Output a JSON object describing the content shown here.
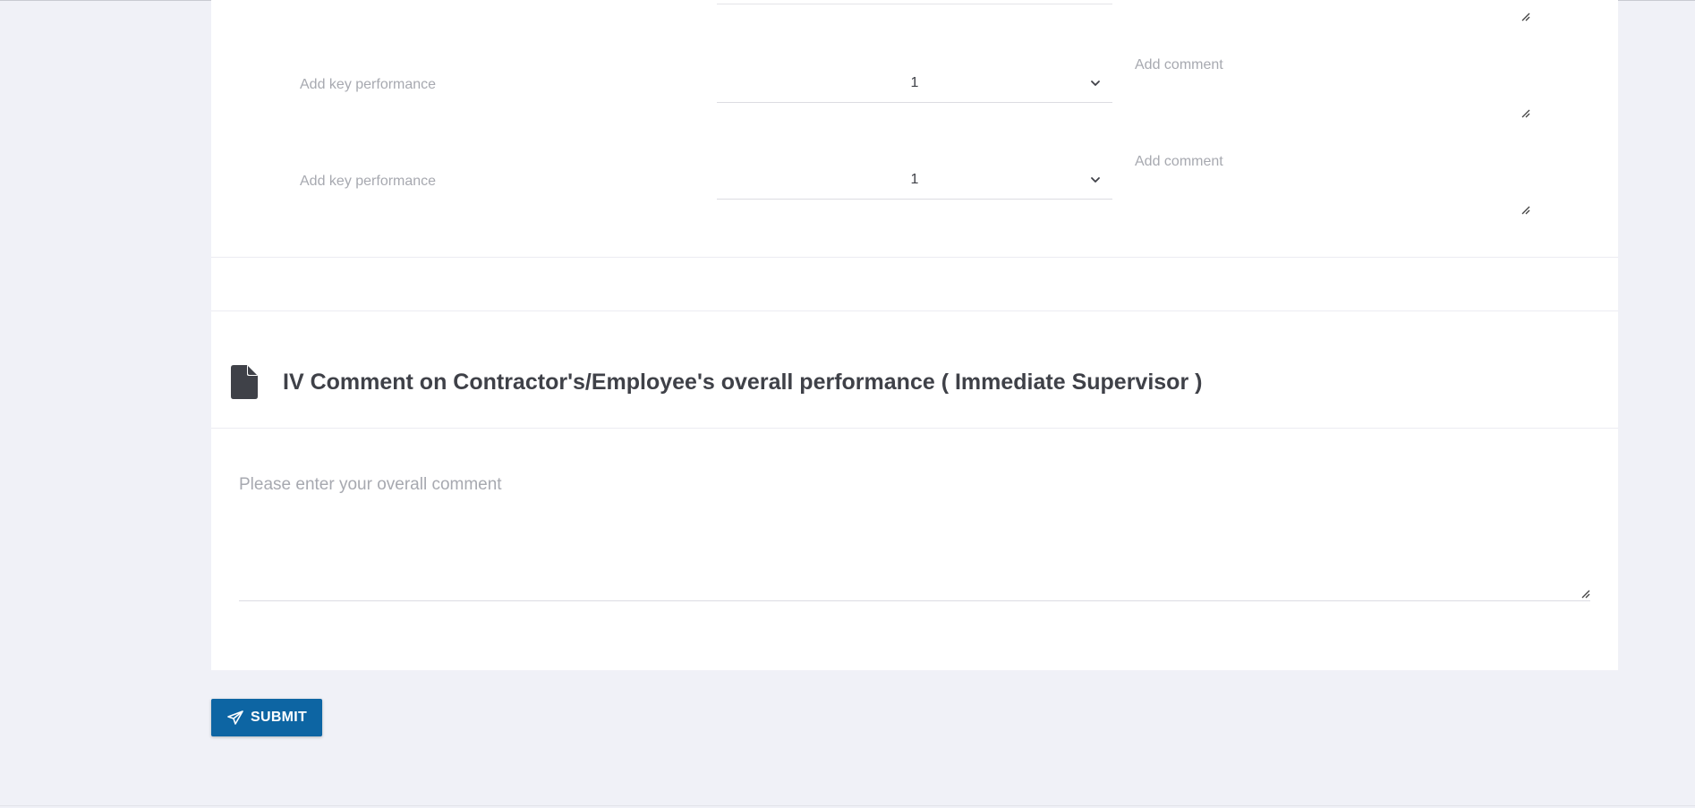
{
  "kpi_section": {
    "rows": [
      {
        "key_performance_placeholder": "Add key performance",
        "rating_value": "1",
        "comment_placeholder": "Add comment"
      },
      {
        "key_performance_placeholder": "Add key performance",
        "rating_value": "1",
        "comment_placeholder": "Add comment"
      }
    ]
  },
  "overall_section": {
    "icon": "file-icon",
    "title": "IV Comment on Contractor's/Employee's overall performance ( Immediate Supervisor )",
    "comment_placeholder": "Please enter your overall comment"
  },
  "submit": {
    "label": "SUBMIT",
    "icon": "paper-plane-icon"
  },
  "colors": {
    "page_background": "#f0f1f7",
    "card_background": "#ffffff",
    "primary": "#0d65a3",
    "heading_text": "#3f4148",
    "placeholder_text": "#a7a9b0"
  }
}
